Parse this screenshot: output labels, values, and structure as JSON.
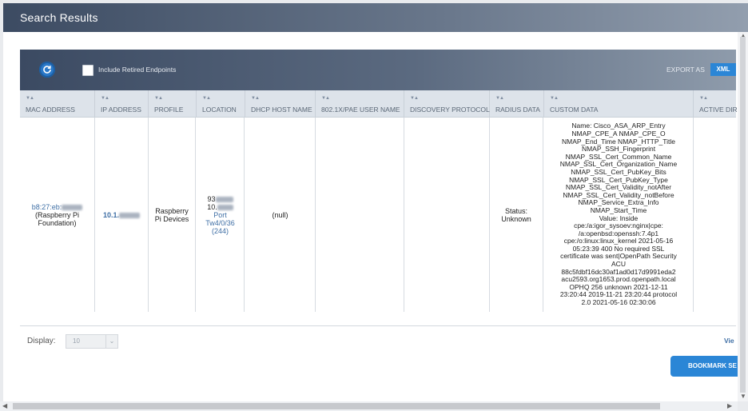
{
  "window": {
    "title": "Search Results"
  },
  "toolbar": {
    "include_retired_label": "Include Retired Endpoints",
    "include_retired_checked": false,
    "export_as_label": "EXPORT AS",
    "xml_label": "XML",
    "refresh_icon": "refresh-icon"
  },
  "table": {
    "columns": [
      "MAC ADDRESS",
      "IP ADDRESS",
      "PROFILE",
      "LOCATION",
      "DHCP HOST NAME",
      "802.1X/PAE USER NAME",
      "DISCOVERY PROTOCOL",
      "RADIUS DATA",
      "CUSTOM DATA",
      "ACTIVE DIR"
    ],
    "row": {
      "mac_prefix": "b8:27:eb:",
      "mac_vendor": "(Raspberry Pi Foundation)",
      "ip_prefix": "10.1.",
      "profile": "Raspberry Pi Devices",
      "location_prefix_1": "93",
      "location_prefix_2": "10.",
      "location_port": "Port Tw4/0/36 (244)",
      "dhcp_host_name": "(null)",
      "pae_user_name": "",
      "discovery_protocol": "",
      "radius_data": "Status: Unknown",
      "custom_data": "Name: Cisco_ASA_ARP_Entry\nNMAP_CPE_A NMAP_CPE_O\nNMAP_End_Time NMAP_HTTP_Title\nNMAP_SSH_Fingerprint\nNMAP_SSL_Cert_Common_Name\nNMAP_SSL_Cert_Organization_Name\nNMAP_SSL_Cert_PubKey_Bits\nNMAP_SSL_Cert_PubKey_Type\nNMAP_SSL_Cert_Validity_notAfter\nNMAP_SSL_Cert_Validity_notBefore\nNMAP_Service_Extra_Info\nNMAP_Start_Time\nValue: Inside\ncpe:/a:igor_sysoev:nginx|cpe:\n/a:openbsd:openssh:7.4p1\ncpe:/o:linux:linux_kernel 2021-05-16\n05:23:39 400 No required SSL\ncertificate was sent|OpenPath Security\nACU\n88c5fdbf16dc30af1ad0d17d9991eda2\nacu2593.org1653.prod.openpath.local\nOPHQ 256 unknown 2021-12-11\n23:20:44 2019-11-21 23:20:44 protocol\n2.0 2021-05-16 02:30:06",
      "active_dir": ""
    }
  },
  "footer": {
    "display_label": "Display:",
    "display_value": "10",
    "view_label": "Vie",
    "bookmark_label": "BOOKMARK SE"
  },
  "colors": {
    "accent": "#2b86d6",
    "header_bg": "#3c4b62",
    "link": "#3f6fa5"
  }
}
